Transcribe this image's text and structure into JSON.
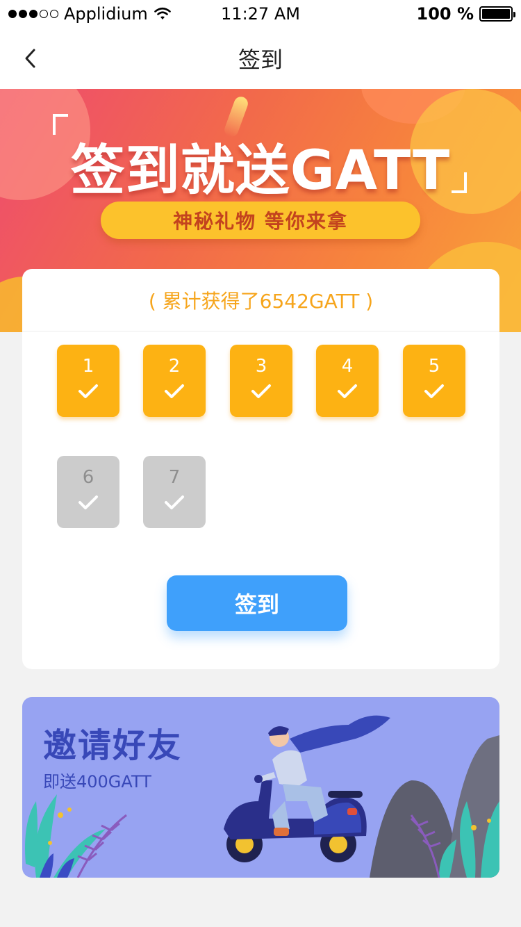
{
  "status_bar": {
    "carrier": "Applidium",
    "time": "11:27 AM",
    "battery": "100 %"
  },
  "nav": {
    "title": "签到",
    "back_icon": "chevron-left-icon"
  },
  "banner": {
    "title": "签到就送GATT",
    "subtitle": "神秘礼物  等你来拿"
  },
  "sign_card": {
    "total_text": "( 累计获得了6542GATT )",
    "days": [
      {
        "label": "1",
        "checked": true
      },
      {
        "label": "2",
        "checked": true
      },
      {
        "label": "3",
        "checked": true
      },
      {
        "label": "4",
        "checked": true
      },
      {
        "label": "5",
        "checked": true
      },
      {
        "label": "6",
        "checked": false
      },
      {
        "label": "7",
        "checked": false
      }
    ],
    "button_label": "签到"
  },
  "invite": {
    "title": "邀请好友",
    "subtitle": "即送400GATT"
  },
  "colors": {
    "accent_blue": "#3fa0fb",
    "day_done": "#fdb213",
    "day_todo": "#cccccc",
    "total_text": "#f6a51c",
    "invite_bg": "#97a3f2",
    "invite_text": "#3848b8"
  }
}
